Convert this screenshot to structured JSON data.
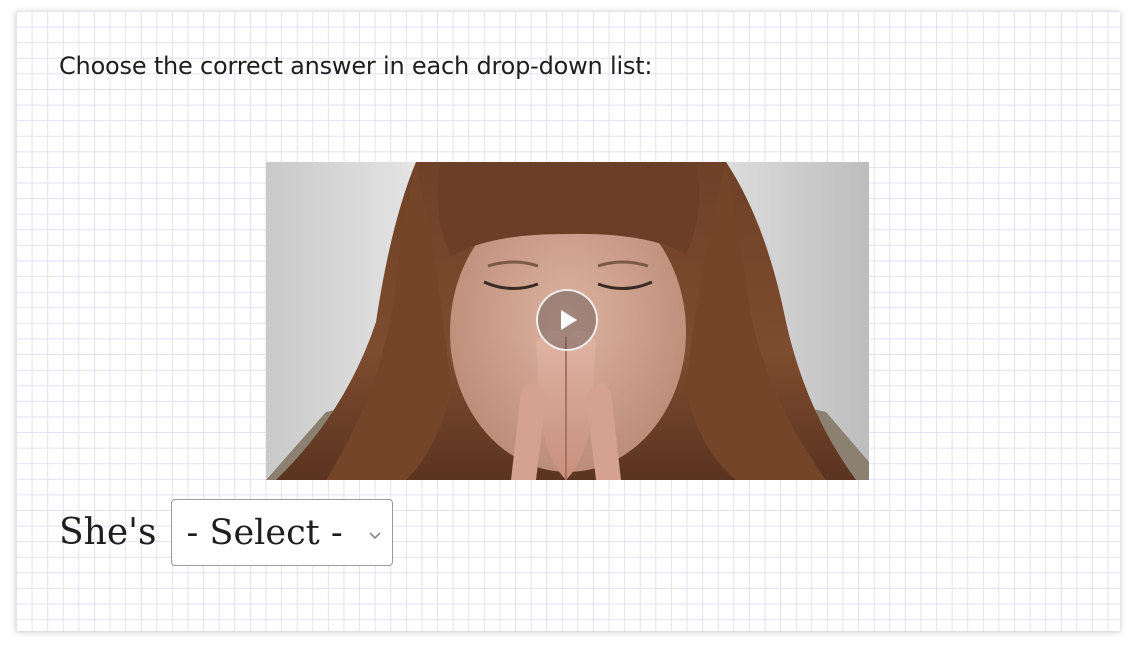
{
  "exercise": {
    "instruction": "Choose the correct answer in each drop-down list:",
    "video": {
      "thumbnail": "woman-praying-with-closed-eyes",
      "play_icon": "play-icon"
    },
    "question": {
      "prefix": "She's",
      "select_value": "- Select -",
      "chevron_icon": "chevron-down-icon"
    }
  },
  "colors": {
    "grid_line": "#e3e1f1",
    "text": "#1e1e1e",
    "select_border": "#9a9a9a"
  }
}
